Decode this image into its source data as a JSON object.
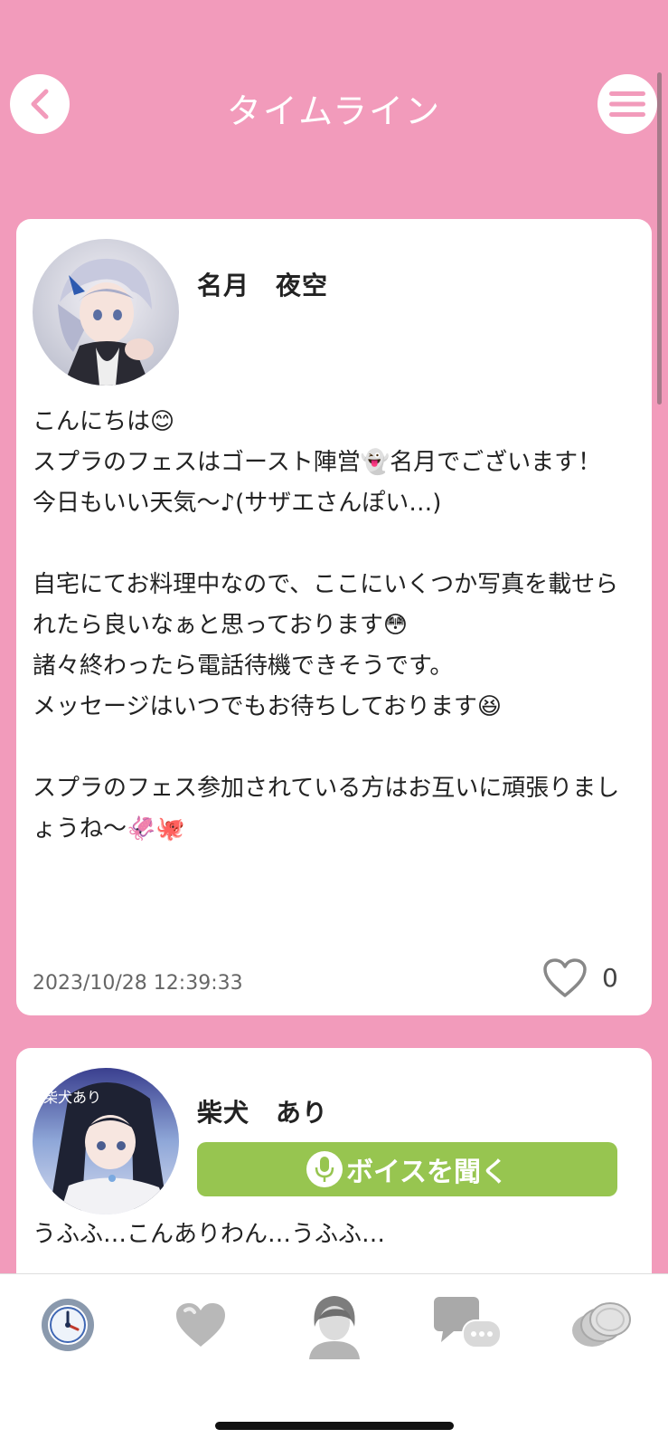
{
  "header": {
    "title": "タイムライン"
  },
  "posts": [
    {
      "name": "名月　夜空",
      "text": "こんにちは😊\nスプラのフェスはゴースト陣営👻名月でございます！\n今日もいい天気〜♪(サザエさんぽい…)\n\n自宅にてお料理中なので、ここにいくつか写真を載せられたら良いなぁと思っております😳\n諸々終わったら電話待機できそうです。\nメッセージはいつでもお待ちしております😆\n\nスプラのフェス参加されている方はお互いに頑張りましょうね〜🦑🐙",
      "timestamp": "2023/10/28 12:39:33",
      "likes": "0"
    },
    {
      "name": "柴犬　あり",
      "voice_label": "ボイスを聞く",
      "avatar_text": "柴犬あり",
      "text": "うふふ…こんありわん…うふふ…"
    }
  ],
  "tabs": [
    {
      "icon": "clock-icon"
    },
    {
      "icon": "heart-icon"
    },
    {
      "icon": "person-icon"
    },
    {
      "icon": "chat-bubbles-icon"
    },
    {
      "icon": "coins-icon"
    }
  ],
  "colors": {
    "background": "#f29bbb",
    "accent_green": "#97c550",
    "card": "#ffffff"
  }
}
